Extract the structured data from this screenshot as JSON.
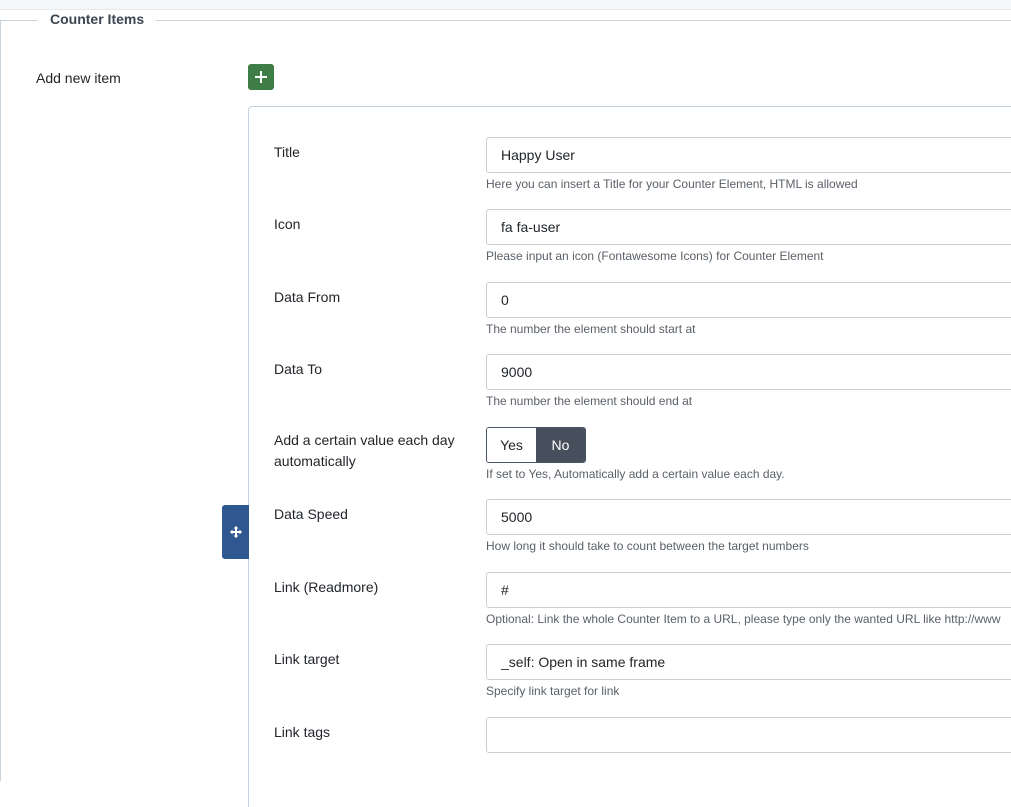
{
  "fieldset": {
    "legend": "Counter Items",
    "add_label": "Add new item"
  },
  "icons": {
    "add": "plus-icon",
    "drag": "move-icon"
  },
  "colors": {
    "add_button": "#3f7d47",
    "drag_handle": "#2f5890",
    "toggle_active": "#474f5c"
  },
  "item": {
    "title": {
      "label": "Title",
      "value": "Happy User",
      "help": "Here you can insert a Title for your Counter Element, HTML is allowed"
    },
    "icon": {
      "label": "Icon",
      "value": "fa fa-user",
      "help": "Please input an icon (Fontawesome Icons) for Counter Element"
    },
    "data_from": {
      "label": "Data From",
      "value": "0",
      "help": "The number the element should start at"
    },
    "data_to": {
      "label": "Data To",
      "value": "9000",
      "help": "The number the element should end at"
    },
    "auto_add": {
      "label": "Add a certain value each day automatically",
      "yes": "Yes",
      "no": "No",
      "selected": "No",
      "help": "If set to Yes, Automatically add a certain value each day."
    },
    "data_speed": {
      "label": "Data Speed",
      "value": "5000",
      "help": "How long it should take to count between the target numbers"
    },
    "link": {
      "label": "Link (Readmore)",
      "value": "#",
      "help": "Optional: Link the whole Counter Item to a URL, please type only the wanted URL like http://www"
    },
    "link_target": {
      "label": "Link target",
      "value": "_self: Open in same frame",
      "help": "Specify link target for link"
    },
    "link_tags": {
      "label": "Link tags",
      "value": ""
    }
  }
}
